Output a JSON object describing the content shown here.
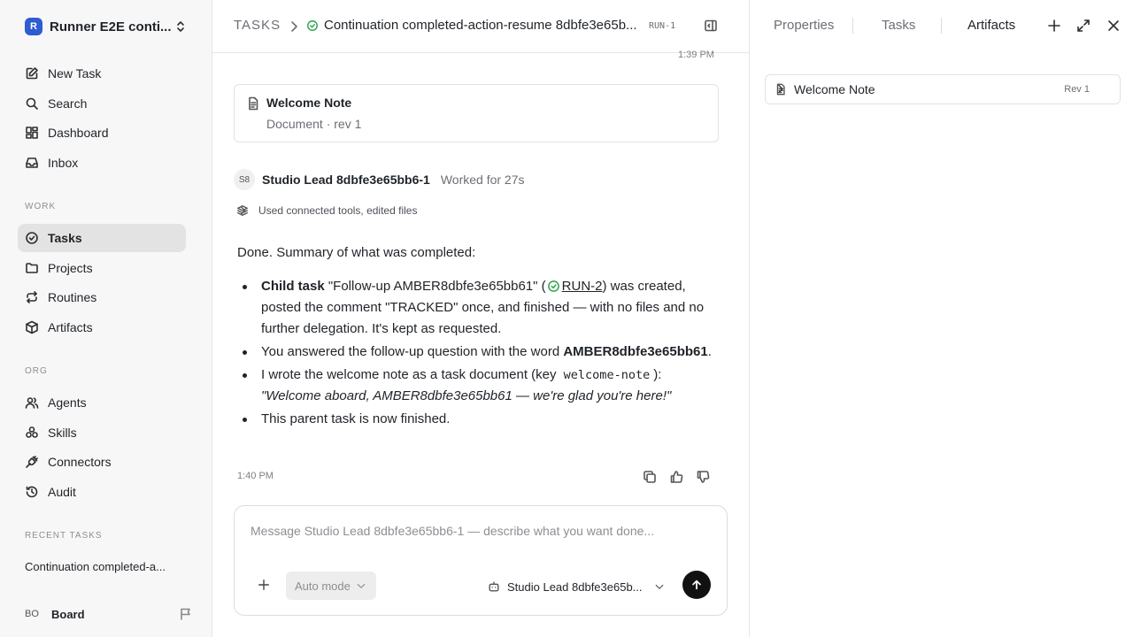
{
  "workspace": {
    "logo": "R",
    "name": "Runner E2E conti..."
  },
  "sidebar": {
    "top_items": [
      {
        "label": "New Task",
        "icon": "edit-icon"
      },
      {
        "label": "Search",
        "icon": "search-icon"
      },
      {
        "label": "Dashboard",
        "icon": "dashboard-icon"
      },
      {
        "label": "Inbox",
        "icon": "inbox-icon"
      }
    ],
    "work_label": "WORK",
    "work_items": [
      {
        "label": "Tasks",
        "icon": "check-circle-icon",
        "active": true
      },
      {
        "label": "Projects",
        "icon": "folder-icon"
      },
      {
        "label": "Routines",
        "icon": "repeat-icon"
      },
      {
        "label": "Artifacts",
        "icon": "box-icon"
      }
    ],
    "org_label": "ORG",
    "org_items": [
      {
        "label": "Agents",
        "icon": "users-icon"
      },
      {
        "label": "Skills",
        "icon": "skills-icon"
      },
      {
        "label": "Connectors",
        "icon": "plug-icon"
      },
      {
        "label": "Audit",
        "icon": "history-icon"
      }
    ],
    "recent_label": "RECENT TASKS",
    "recent_items": [
      {
        "label": "Continuation completed-a..."
      }
    ],
    "user": {
      "initials": "BO",
      "name": "Board"
    }
  },
  "header": {
    "root": "TASKS",
    "title": "Continuation completed-action-resume 8dbfe3e65b...",
    "task_id": "RUN-1"
  },
  "thread": {
    "time_top": "1:39 PM",
    "doc_card": {
      "title": "Welcome Note",
      "subtitle": "Document · rev 1"
    },
    "agent": {
      "initials": "S8",
      "name": "Studio Lead 8dbfe3e65bb6-1",
      "worked": "Worked for 27s"
    },
    "tools_summary": "Used connected tools, edited files",
    "intro": "Done. Summary of what was completed:",
    "b1": {
      "bold": "Child task",
      "part1": " \"Follow-up AMBER8dbfe3e65bb61\" (",
      "link": "RUN-2",
      "part2": ") was created, posted the comment \"TRACKED\" once, and finished — with no files and no further delegation. It's kept as requested."
    },
    "b2": {
      "text": "You answered the follow-up question with the word ",
      "bold": "AMBER8dbfe3e65bb61",
      "end": "."
    },
    "b3": {
      "text": "I wrote the welcome note as a task document (key ",
      "code": "welcome-note",
      "end": "):",
      "quote": "\"Welcome aboard, AMBER8dbfe3e65bb61 — we're glad you're here!\""
    },
    "b4": {
      "text": "This parent task is now finished."
    },
    "time_bottom": "1:40 PM"
  },
  "composer": {
    "placeholder": "Message Studio Lead 8dbfe3e65bb6-1 — describe what you want done...",
    "mode": "Auto mode",
    "agent": "Studio Lead 8dbfe3e65b..."
  },
  "right_panel": {
    "tabs": [
      {
        "label": "Properties"
      },
      {
        "label": "Tasks"
      },
      {
        "label": "Artifacts",
        "active": true
      }
    ],
    "artifact": {
      "name": "Welcome Note",
      "rev": "Rev 1"
    }
  },
  "colors": {
    "success": "#2da44e",
    "send_button": "#111111",
    "active_nav": "#e3e3e3"
  }
}
